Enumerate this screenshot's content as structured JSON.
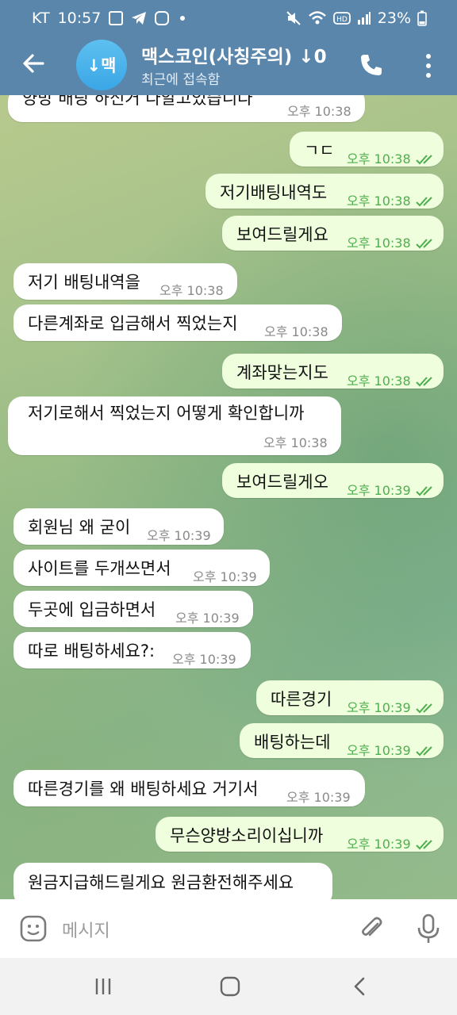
{
  "status_bar": {
    "carrier": "KT",
    "time": "10:57",
    "battery": "23%",
    "icons": [
      "gallery-icon",
      "telegram-icon",
      "instagram-icon",
      "mute-icon",
      "wifi-icon",
      "hd-icon",
      "signal-icon",
      "battery-icon"
    ]
  },
  "header": {
    "avatar_text": "↓맥",
    "title": "맥스코인(사칭주의) ↓0",
    "subtitle": "최근에 접속함",
    "colors": {
      "bar": "#5a86ac",
      "avatar": "#3aa6e6"
    }
  },
  "messages": [
    {
      "dir": "in",
      "text": "양방 배팅 하신거 다알고있습니다",
      "time": "오후 10:38"
    },
    {
      "dir": "out",
      "text": "ㄱㄷ",
      "time": "오후 10:38",
      "read": true
    },
    {
      "dir": "out",
      "text": "저기배팅내역도",
      "time": "오후 10:38",
      "read": true
    },
    {
      "dir": "out",
      "text": "보여드릴게요",
      "time": "오후 10:38",
      "read": true
    },
    {
      "dir": "in",
      "text": "저기 배팅내역을",
      "time": "오후 10:38"
    },
    {
      "dir": "in",
      "text": "다른계좌로 입금해서 찍었는지",
      "time": "오후 10:38"
    },
    {
      "dir": "out",
      "text": "계좌맞는지도",
      "time": "오후 10:38",
      "read": true
    },
    {
      "dir": "in",
      "text": "저기로해서 찍었는지 어떻게 확인합니까",
      "time": "오후 10:38"
    },
    {
      "dir": "out",
      "text": "보여드릴게오",
      "time": "오후 10:39",
      "read": true
    },
    {
      "dir": "in",
      "text": "회원님 왜 굳이",
      "time": "오후 10:39"
    },
    {
      "dir": "in",
      "text": "사이트를 두개쓰면서",
      "time": "오후 10:39"
    },
    {
      "dir": "in",
      "text": "두곳에 입금하면서",
      "time": "오후 10:39"
    },
    {
      "dir": "in",
      "text": "따로 배팅하세요?:",
      "time": "오후 10:39"
    },
    {
      "dir": "out",
      "text": "따른경기",
      "time": "오후 10:39",
      "read": true
    },
    {
      "dir": "out",
      "text": "배팅하는데",
      "time": "오후 10:39",
      "read": true
    },
    {
      "dir": "in",
      "text": "따른경기를 왜 배팅하세요 거기서",
      "time": "오후 10:39"
    },
    {
      "dir": "out",
      "text": "무슨양방소리이십니까",
      "time": "오후 10:39",
      "read": true
    },
    {
      "dir": "in",
      "text": "원금지급해드릴게요 원금환전해주세요",
      "time": ""
    }
  ],
  "input": {
    "placeholder": "메시지"
  },
  "colors": {
    "incoming_bubble": "#ffffff",
    "outgoing_bubble": "#effedd",
    "outgoing_meta": "#4fae4e"
  }
}
